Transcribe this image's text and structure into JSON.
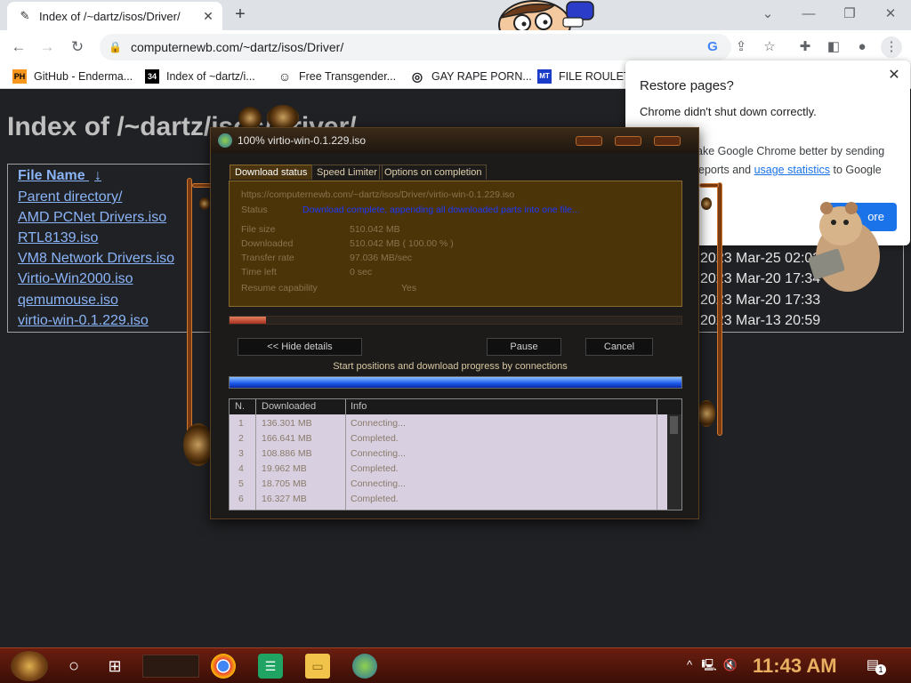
{
  "tab": {
    "title": "Index of /~dartz/isos/Driver/",
    "close_glyph": "✕"
  },
  "newtab_glyph": "+",
  "toolbar": {
    "url": "computernewb.com/~dartz/isos/Driver/",
    "back": "←",
    "forward": "→",
    "reload": "↻"
  },
  "bookmarks": [
    {
      "icon": "PH",
      "label": "GitHub - Enderma..."
    },
    {
      "icon": "34",
      "label": "Index of ~dartz/i..."
    },
    {
      "icon": "☺",
      "label": "Free Transgender..."
    },
    {
      "icon": "◎",
      "label": "GAY RAPE PORN..."
    },
    {
      "icon": "MT",
      "label": "FILE ROULETTE"
    }
  ],
  "page": {
    "title": "Index of /~dartz/isos/Driver/",
    "column_header": "File Name",
    "sort_arrow": "↓",
    "files": [
      {
        "name": "Parent directory/",
        "date": ""
      },
      {
        "name": "AMD PCNet Drivers.iso",
        "date": ""
      },
      {
        "name": "RTL8139.iso",
        "date": ""
      },
      {
        "name": "VM8 Network Drivers.iso",
        "date": "2023 Mar-25 02:02"
      },
      {
        "name": "Virtio-Win2000.iso",
        "date": "2023 Mar-20 17:34"
      },
      {
        "name": "qemumouse.iso",
        "date": "2023 Mar-20 17:33"
      },
      {
        "name": "virtio-win-0.1.229.iso",
        "date": "2023 Mar-13 20:59"
      }
    ]
  },
  "restore_popup": {
    "title": "Restore pages?",
    "message": "Chrome didn't shut down correctly.",
    "hint_prefix": "ake Google Chrome better by sending",
    "hint_mid": "eports and",
    "hint_link": "usage statistics",
    "hint_suffix": "to Google",
    "button": "ore"
  },
  "idm": {
    "title": "100% virtio-win-0.1.229.iso",
    "tabs": [
      "Download status",
      "Speed Limiter",
      "Options on completion"
    ],
    "url": "https://computernewb.com/~dartz/isos/Driver/virtio-win-0.1.229.iso",
    "status_label": "Status",
    "status_value": "Download complete, appending all downloaded parts into one file...",
    "rows": [
      {
        "label": "File size",
        "value": "510.042  MB"
      },
      {
        "label": "Downloaded",
        "value": "510.042  MB  ( 100.00 % )"
      },
      {
        "label": "Transfer rate",
        "value": "97.036  MB/sec"
      },
      {
        "label": "Time left",
        "value": "0 sec"
      }
    ],
    "resume_label": "Resume capability",
    "resume_value": "Yes",
    "progress_fraction": 0.08,
    "buttons": {
      "hide": "<< Hide details",
      "pause": "Pause",
      "cancel": "Cancel"
    },
    "connections_label": "Start positions and download progress by connections",
    "table_headers": [
      "N.",
      "Downloaded",
      "Info"
    ],
    "connections": [
      {
        "n": "1",
        "downloaded": "136.301  MB",
        "info": "Connecting..."
      },
      {
        "n": "2",
        "downloaded": "166.641  MB",
        "info": "Completed."
      },
      {
        "n": "3",
        "downloaded": "108.886  MB",
        "info": "Connecting..."
      },
      {
        "n": "4",
        "downloaded": "19.962  MB",
        "info": "Completed."
      },
      {
        "n": "5",
        "downloaded": "18.705  MB",
        "info": "Connecting..."
      },
      {
        "n": "6",
        "downloaded": "16.327  MB",
        "info": "Completed."
      }
    ]
  },
  "taskbar": {
    "clock": "11:43 AM",
    "notification_count": "1"
  },
  "colors": {
    "link": "#8ab4f8",
    "accent": "#1a73e8",
    "taskbar": "#5a1a0c",
    "clock": "#e8b060"
  }
}
